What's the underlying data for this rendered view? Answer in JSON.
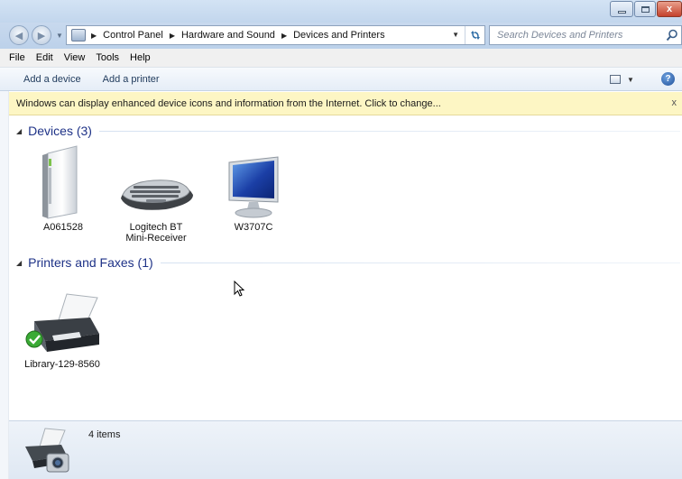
{
  "window": {
    "controls": [
      "minimize",
      "maximize",
      "close"
    ],
    "close_glyph": "x"
  },
  "nav": {
    "back_icon": "back-arrow-icon",
    "forward_icon": "forward-arrow-icon",
    "breadcrumbs": [
      "Control Panel",
      "Hardware and Sound",
      "Devices and Printers"
    ],
    "search_placeholder": "Search Devices and Printers"
  },
  "menubar": {
    "items": [
      "File",
      "Edit",
      "View",
      "Tools",
      "Help"
    ]
  },
  "commandbar": {
    "add_device": "Add a device",
    "add_printer": "Add a printer",
    "help_glyph": "?"
  },
  "infobar": {
    "text": "Windows can display enhanced device icons and information from the Internet. Click to change...",
    "close_glyph": "x"
  },
  "groups": {
    "devices": {
      "title": "Devices (3)",
      "items": [
        {
          "label_lines": [
            "A061528"
          ],
          "icon": "computer-tower-icon"
        },
        {
          "label_lines": [
            "Logitech BT",
            "Mini-Receiver"
          ],
          "icon": "keyboard-icon"
        },
        {
          "label_lines": [
            "W3707C"
          ],
          "icon": "monitor-icon"
        }
      ]
    },
    "printers": {
      "title": "Printers and Faxes (1)",
      "items": [
        {
          "label_lines": [
            "Library-129-8560"
          ],
          "icon": "printer-icon",
          "default": true
        }
      ]
    }
  },
  "statusbar": {
    "count_text": "4 items",
    "icon": "printer-camera-icon"
  },
  "colors": {
    "group_header": "#1e3287",
    "infobar_bg": "#fdf6c4",
    "command_text": "#1e395b"
  }
}
